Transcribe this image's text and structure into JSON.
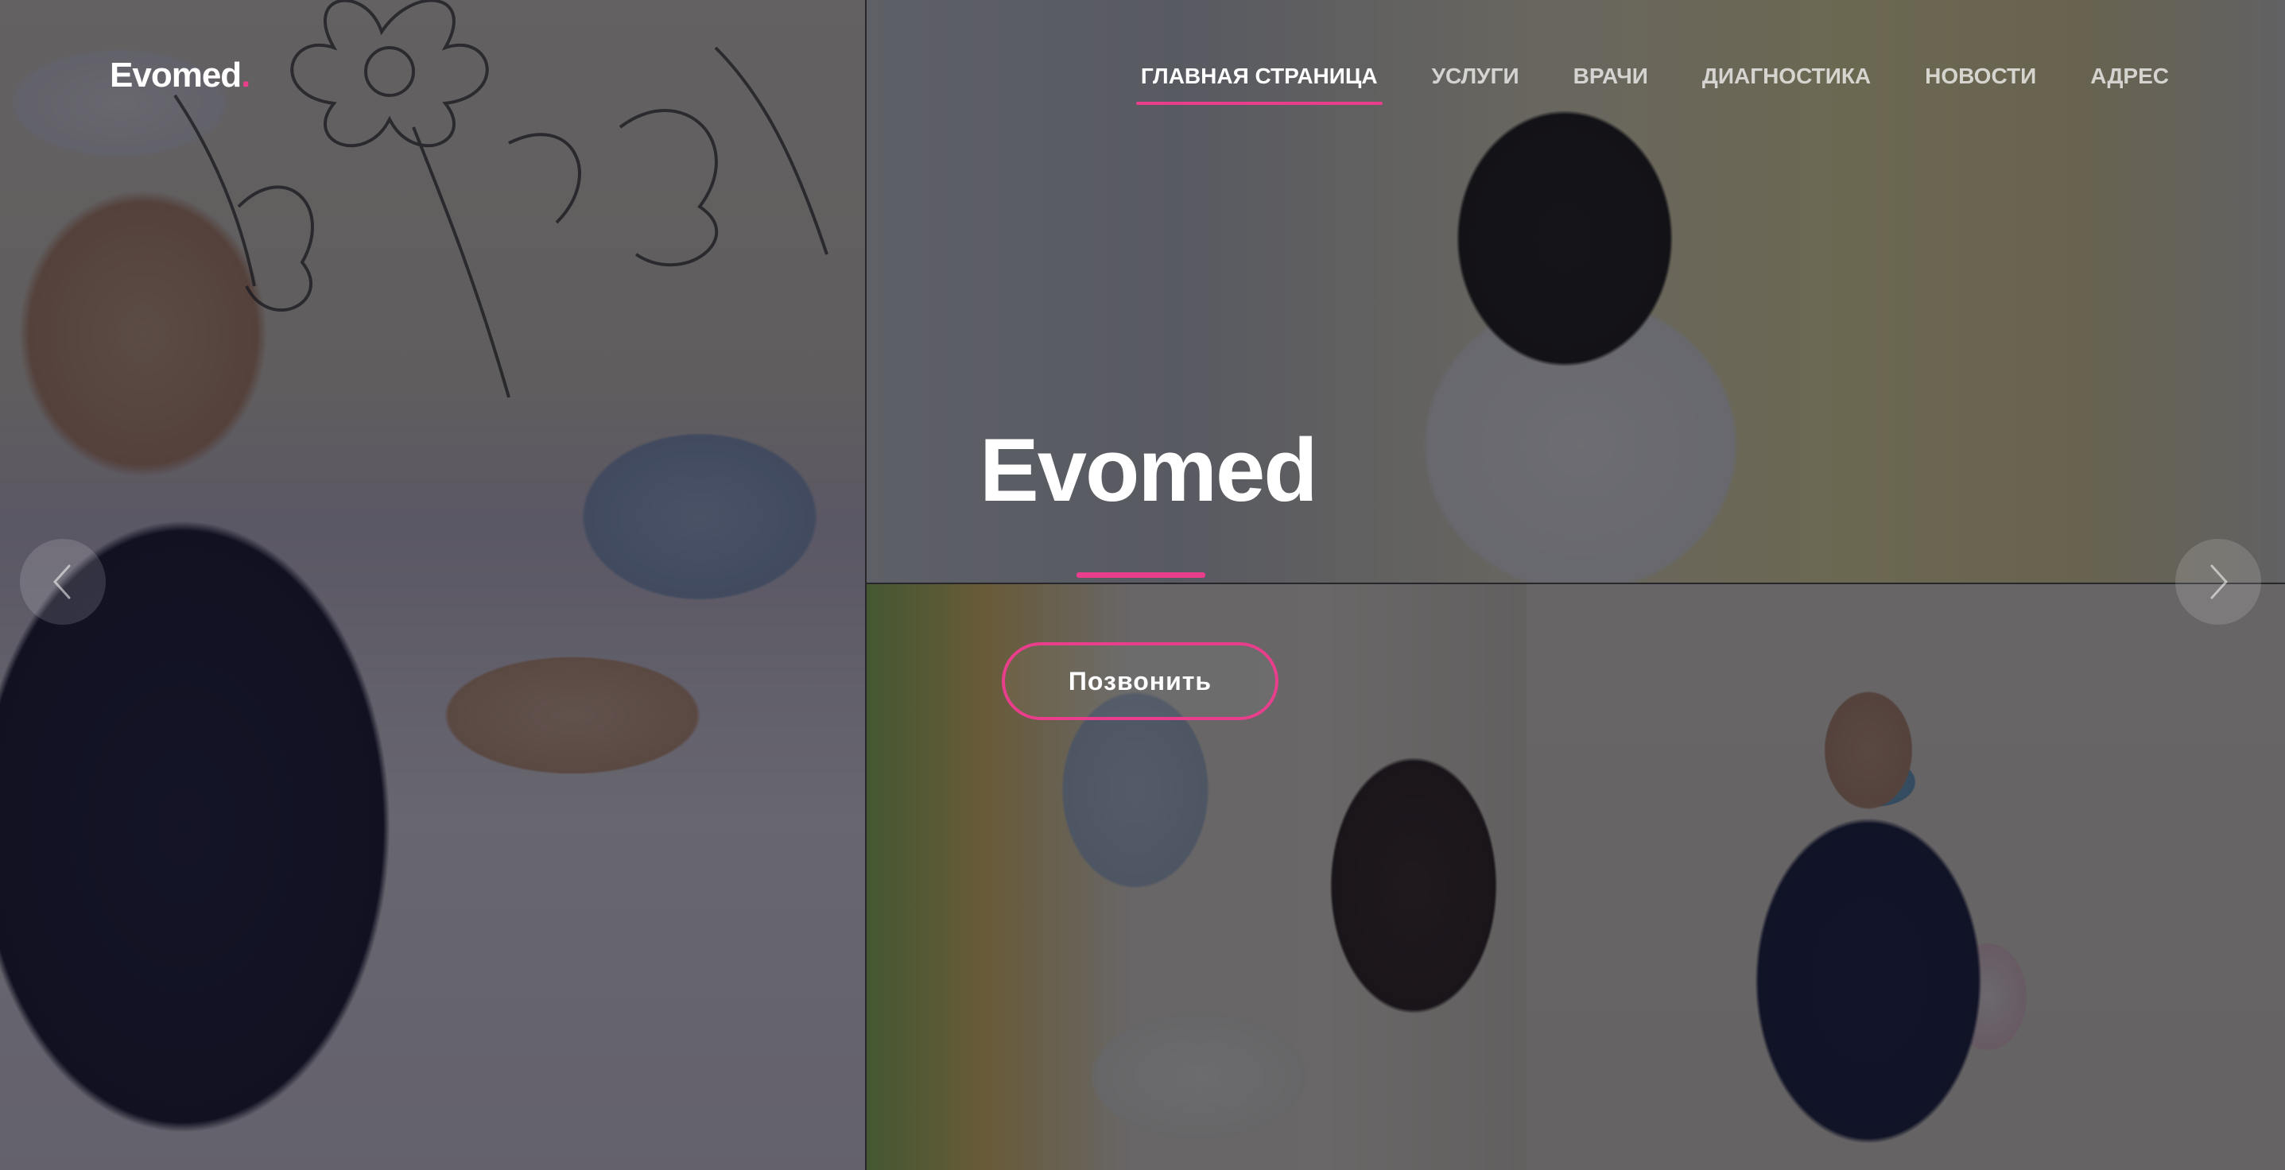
{
  "header": {
    "logo_text": "Evomed",
    "logo_dot": ".",
    "nav": [
      {
        "label": "ГЛАВНАЯ СТРАНИЦА",
        "active": true
      },
      {
        "label": "УСЛУГИ",
        "active": false
      },
      {
        "label": "ВРАЧИ",
        "active": false
      },
      {
        "label": "ДИАГНОСТИКА",
        "active": false
      },
      {
        "label": "НОВОСТИ",
        "active": false
      },
      {
        "label": "АДРЕС",
        "active": false
      }
    ]
  },
  "hero": {
    "title": "Evomed",
    "cta_label": "Позвонить"
  },
  "slider": {
    "prev_icon": "chevron-left-icon",
    "next_icon": "chevron-right-icon"
  },
  "colors": {
    "accent": "#e83e8c",
    "text": "#ffffff"
  }
}
